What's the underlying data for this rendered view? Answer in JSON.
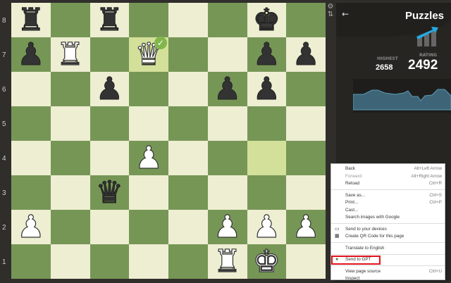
{
  "board": {
    "ranks": [
      "8",
      "7",
      "6",
      "5",
      "4",
      "3",
      "2",
      "1"
    ],
    "pieces": {
      "a8": {
        "glyph": "♜",
        "color": "black",
        "name": "black-rook"
      },
      "c8": {
        "glyph": "♜",
        "color": "black",
        "name": "black-rook"
      },
      "g8": {
        "glyph": "♚",
        "color": "black",
        "name": "black-king"
      },
      "a7": {
        "glyph": "♟",
        "color": "black",
        "name": "black-pawn"
      },
      "b7": {
        "glyph": "♜",
        "color": "white",
        "name": "white-rook"
      },
      "d7": {
        "glyph": "♛",
        "color": "white",
        "name": "white-queen"
      },
      "g7": {
        "glyph": "♟",
        "color": "black",
        "name": "black-pawn"
      },
      "h7": {
        "glyph": "♟",
        "color": "black",
        "name": "black-pawn"
      },
      "c6": {
        "glyph": "♟",
        "color": "black",
        "name": "black-pawn"
      },
      "f6": {
        "glyph": "♟",
        "color": "black",
        "name": "black-pawn"
      },
      "g6": {
        "glyph": "♟",
        "color": "black",
        "name": "black-pawn"
      },
      "d4": {
        "glyph": "♟",
        "color": "white",
        "name": "white-pawn"
      },
      "c3": {
        "glyph": "♛",
        "color": "black",
        "name": "black-queen"
      },
      "a2": {
        "glyph": "♟",
        "color": "white",
        "name": "white-pawn"
      },
      "f2": {
        "glyph": "♟",
        "color": "white",
        "name": "white-pawn"
      },
      "g2": {
        "glyph": "♟",
        "color": "white",
        "name": "white-pawn"
      },
      "h2": {
        "glyph": "♟",
        "color": "white",
        "name": "white-pawn"
      },
      "f1": {
        "glyph": "♜",
        "color": "white",
        "name": "white-rook"
      },
      "g1": {
        "glyph": "♚",
        "color": "white",
        "name": "white-king"
      }
    },
    "highlighted": [
      "d7",
      "g4"
    ],
    "check_square": "d7",
    "check_glyph": "✓",
    "colors": {
      "light": "#eeeed2",
      "dark": "#769656"
    }
  },
  "panel": {
    "title": "Puzzles",
    "back_icon": "←",
    "highest_label": "HIGHEST",
    "highest": "2658",
    "rating_label": "RATING",
    "rating": "2492"
  },
  "side_icons": {
    "settings": "⚙",
    "flip": "⇅"
  },
  "menu": {
    "back": "Back",
    "back_sc": "Alt+Left Arrow",
    "forward": "Forward",
    "forward_sc": "Alt+Right Arrow",
    "reload": "Reload",
    "reload_sc": "Ctrl+R",
    "save": "Save as...",
    "save_sc": "Ctrl+S",
    "print": "Print...",
    "print_sc": "Ctrl+P",
    "cast": "Cast...",
    "search_images": "Search images with Google",
    "send_devices": "Send to your devices",
    "qr": "Create QR Code for this page",
    "translate": "Translate to English",
    "send_gpt": "Send to GPT",
    "view_source": "View page source",
    "view_source_sc": "Ctrl+U",
    "inspect": "Inspect"
  }
}
